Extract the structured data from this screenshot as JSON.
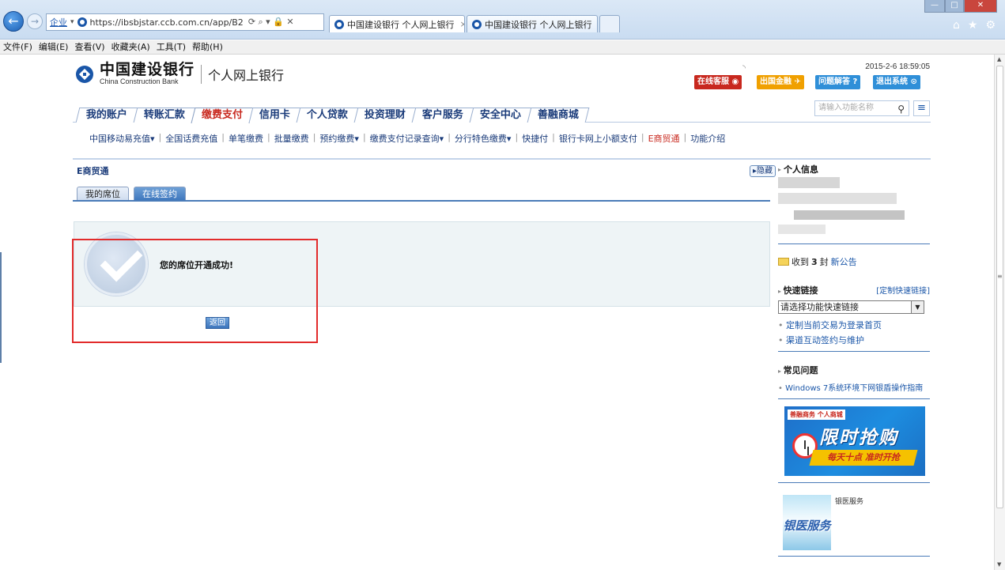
{
  "browser": {
    "address_prefix": "企业",
    "url": "https://ibsbjstar.ccb.com.cn/app/B2",
    "tabs": [
      {
        "label": "中国建设银行 个人网上银行"
      },
      {
        "label": "中国建设银行 个人网上银行"
      }
    ],
    "menu": [
      "文件(F)",
      "编辑(E)",
      "查看(V)",
      "收藏夹(A)",
      "工具(T)",
      "帮助(H)"
    ]
  },
  "header": {
    "bank_name_cn": "中国建设银行",
    "bank_name_en": "China Construction Bank",
    "product": "个人网上银行",
    "datetime": "2015-2-6 18:59:05",
    "buttons": {
      "service": "在线客服",
      "abroad": "出国金融",
      "faq": "问题解答",
      "logout": "退出系统"
    }
  },
  "main_nav": [
    {
      "label": "我的账户"
    },
    {
      "label": "转账汇款"
    },
    {
      "label": "缴费支付",
      "active": true
    },
    {
      "label": "信用卡"
    },
    {
      "label": "个人贷款"
    },
    {
      "label": "投资理财"
    },
    {
      "label": "客户服务"
    },
    {
      "label": "安全中心"
    },
    {
      "label": "善融商城"
    }
  ],
  "search": {
    "placeholder": "请输入功能名称"
  },
  "sub_nav": [
    "中国移动易充值▾",
    "全国话费充值",
    "单笔缴费",
    "批量缴费",
    "预约缴费▾",
    "缴费支付记录查询▾",
    "分行特色缴费▾",
    "快捷付",
    "银行卡网上小额支付",
    "E商贸通",
    "功能介绍"
  ],
  "content": {
    "breadcrumb": "E商贸通",
    "hide_label": "隐藏",
    "subtabs": [
      {
        "label": "我的席位"
      },
      {
        "label": "在线签约",
        "active": true
      }
    ],
    "success_message": "您的席位开通成功!",
    "back_button": "返回"
  },
  "sidebar": {
    "personal_info_title": "个人信息",
    "notice_prefix": "收到",
    "notice_count": "3",
    "notice_mid": "封",
    "notice_link": "新公告",
    "quick_links_title": "快速链接",
    "customize_link": "[定制快速链接]",
    "quick_select_value": "请选择功能快速链接",
    "quick_items": [
      "定制当前交易为登录首页",
      "渠道互动签约与维护"
    ],
    "faq_title": "常见问题",
    "faq_item": "Windows 7系统环境下网银盾操作指南",
    "promo": {
      "tag": "善融商务 个人商城",
      "headline": "限时抢购",
      "ribbon": "每天十点 准时开抢"
    },
    "medical": {
      "image_text": "银医服务",
      "label": "银医服务"
    }
  },
  "colors": {
    "brand_blue": "#1a56a8",
    "active_red": "#c8281e",
    "panel_bg": "#eef4f6",
    "frame_red": "#e22b2b"
  }
}
